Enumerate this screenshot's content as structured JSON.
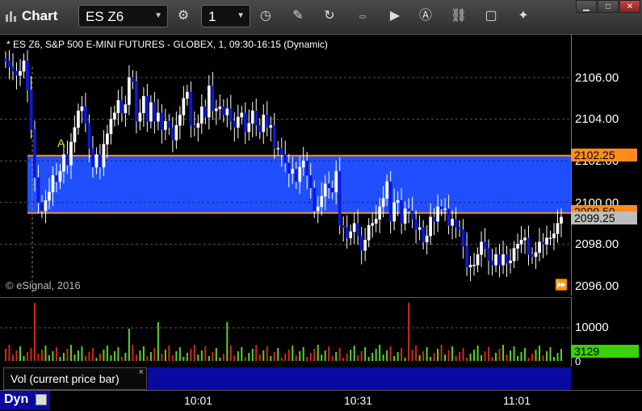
{
  "toolbar": {
    "app_title": "Chart",
    "symbol": "ES Z6",
    "interval": "1"
  },
  "chart": {
    "title": "* ES Z6, S&P 500 E-MINI FUTURES - GLOBEX, 1, 09:30-16:15 (Dynamic)",
    "copyright": "© eSignal, 2016",
    "annotation": "A",
    "price_ticks": [
      "2106.00",
      "2104.00",
      "2102.00",
      "2100.00",
      "2098.00",
      "2096.00"
    ],
    "upper_line_price": "2102.25",
    "lower_line_price": "2099.50",
    "current_price": "2099.25"
  },
  "volume": {
    "legend": "Vol (current price bar)",
    "tick_10000": "10000",
    "tick_0": "0",
    "current_volume": "3129"
  },
  "time_axis": {
    "dyn_label": "Dyn",
    "ticks": [
      "10:01",
      "10:31",
      "11:01"
    ]
  },
  "colors": {
    "band": "#1f4fff",
    "level_line": "#ff8c1a",
    "up_candle": "#ffffff",
    "down_candle": "#0a1ad8",
    "vol_up": "#5bd32a",
    "vol_down": "#d42a1a",
    "vol_tag": "#39d10a"
  },
  "chart_data": {
    "type": "candlestick",
    "ylim": [
      2096,
      2107.6
    ],
    "closes": [
      2106.8,
      2106.5,
      2106.3,
      2106.1,
      2106.3,
      2106.8,
      2105.4,
      2103.5,
      2101.2,
      2100.0,
      2099.6,
      2100.1,
      2100.5,
      2101.3,
      2101.0,
      2101.5,
      2102.3,
      2101.8,
      2102.9,
      2103.6,
      2104.4,
      2104.6,
      2103.8,
      2102.6,
      2101.7,
      2102.3,
      2101.7,
      2102.8,
      2103.3,
      2104.0,
      2104.3,
      2104.9,
      2104.3,
      2104.7,
      2106.0,
      2105.8,
      2103.9,
      2104.3,
      2105.1,
      2103.9,
      2104.8,
      2103.9,
      2104.3,
      2103.5,
      2103.9,
      2103.6,
      2103.0,
      2103.7,
      2104.2,
      2105.0,
      2105.3,
      2103.7,
      2103.6,
      2103.8,
      2104.6,
      2104.1,
      2105.6,
      2104.4,
      2104.5,
      2104.6,
      2104.2,
      2104.5,
      2103.9,
      2103.6,
      2104.1,
      2104.3,
      2103.4,
      2103.8,
      2104.4,
      2103.7,
      2103.4,
      2104.2,
      2103.6,
      2103.7,
      2102.6,
      2102.6,
      2102.3,
      2101.9,
      2101.4,
      2101.6,
      2101.0,
      2101.7,
      2102.0,
      2101.3,
      2100.7,
      2099.6,
      2099.8,
      2100.3,
      2100.9,
      2100.7,
      2100.5,
      2101.5,
      2098.9,
      2098.8,
      2098.3,
      2098.6,
      2099.0,
      2098.4,
      2097.7,
      2098.2,
      2098.9,
      2099.0,
      2099.2,
      2099.8,
      2100.2,
      2101.0,
      2099.1,
      2100.0,
      2100.1,
      2099.0,
      2099.7,
      2099.6,
      2099.2,
      2098.7,
      2098.8,
      2098.1,
      2098.4,
      2099.3,
      2099.1,
      2099.8,
      2099.7,
      2099.7,
      2098.9,
      2099.2,
      2098.8,
      2098.7,
      2097.9,
      2096.9,
      2097.0,
      2097.0,
      2097.5,
      2098.1,
      2097.8,
      2097.2,
      2097.0,
      2097.5,
      2097.0,
      2097.5,
      2097.1,
      2097.2,
      2097.8,
      2098.0,
      2098.2,
      2098.3,
      2097.5,
      2097.4,
      2097.6,
      2098.1,
      2098.0,
      2098.3,
      2098.3,
      2098.5,
      2099.0,
      2099.3
    ]
  }
}
